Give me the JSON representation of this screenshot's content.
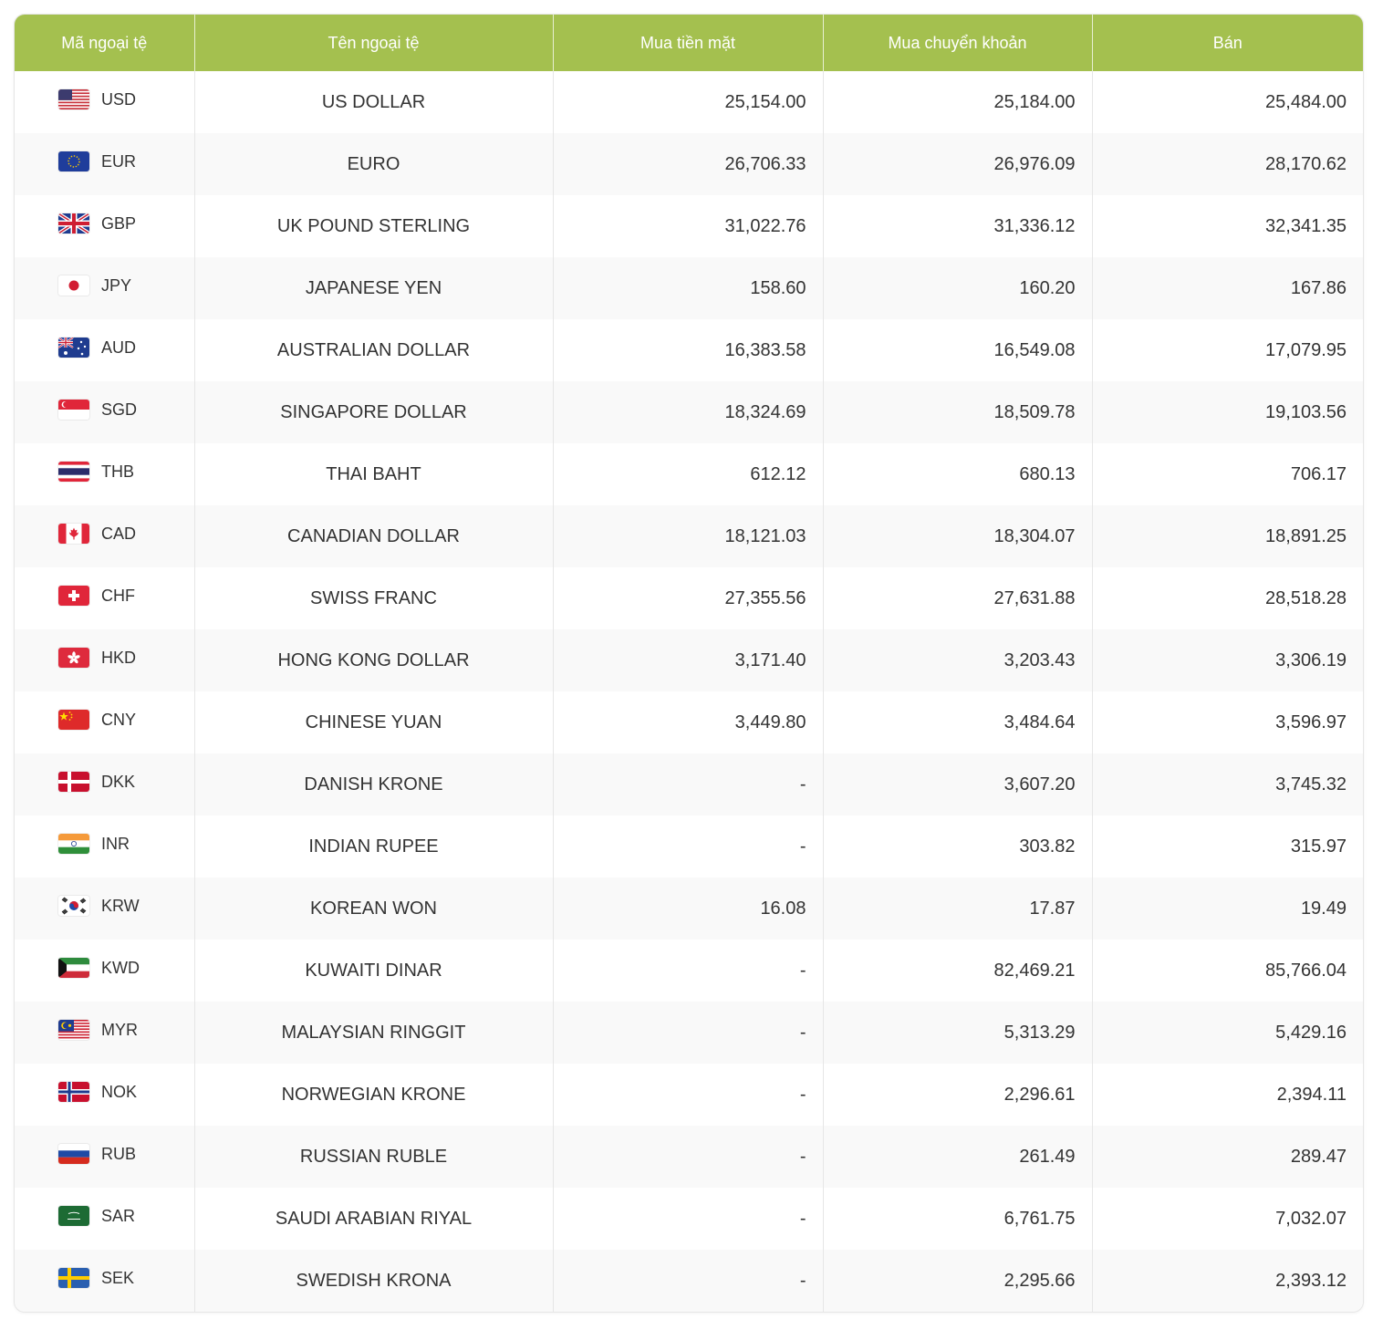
{
  "table": {
    "headers": {
      "code": "Mã ngoại tệ",
      "name": "Tên ngoại tệ",
      "cash_buy": "Mua tiền mặt",
      "transfer_buy": "Mua chuyển khoản",
      "sell": "Bán"
    },
    "header_color": "#a4c04f",
    "rows": [
      {
        "code": "USD",
        "flag": "us-flag",
        "name": "US DOLLAR",
        "cash": "25,154.00",
        "transfer": "25,184.00",
        "sell": "25,484.00"
      },
      {
        "code": "EUR",
        "flag": "eu-flag",
        "name": "EURO",
        "cash": "26,706.33",
        "transfer": "26,976.09",
        "sell": "28,170.62"
      },
      {
        "code": "GBP",
        "flag": "uk-flag",
        "name": "UK POUND STERLING",
        "cash": "31,022.76",
        "transfer": "31,336.12",
        "sell": "32,341.35"
      },
      {
        "code": "JPY",
        "flag": "japan-flag",
        "name": "JAPANESE YEN",
        "cash": "158.60",
        "transfer": "160.20",
        "sell": "167.86"
      },
      {
        "code": "AUD",
        "flag": "australia-flag",
        "name": "AUSTRALIAN DOLLAR",
        "cash": "16,383.58",
        "transfer": "16,549.08",
        "sell": "17,079.95"
      },
      {
        "code": "SGD",
        "flag": "singapore-flag",
        "name": "SINGAPORE DOLLAR",
        "cash": "18,324.69",
        "transfer": "18,509.78",
        "sell": "19,103.56"
      },
      {
        "code": "THB",
        "flag": "thailand-flag",
        "name": "THAI BAHT",
        "cash": "612.12",
        "transfer": "680.13",
        "sell": "706.17"
      },
      {
        "code": "CAD",
        "flag": "canada-flag",
        "name": "CANADIAN DOLLAR",
        "cash": "18,121.03",
        "transfer": "18,304.07",
        "sell": "18,891.25"
      },
      {
        "code": "CHF",
        "flag": "switzerland-flag",
        "name": "SWISS FRANC",
        "cash": "27,355.56",
        "transfer": "27,631.88",
        "sell": "28,518.28"
      },
      {
        "code": "HKD",
        "flag": "hong-kong-flag",
        "name": "HONG KONG DOLLAR",
        "cash": "3,171.40",
        "transfer": "3,203.43",
        "sell": "3,306.19"
      },
      {
        "code": "CNY",
        "flag": "china-flag",
        "name": "CHINESE YUAN",
        "cash": "3,449.80",
        "transfer": "3,484.64",
        "sell": "3,596.97"
      },
      {
        "code": "DKK",
        "flag": "denmark-flag",
        "name": "DANISH KRONE",
        "cash": "-",
        "transfer": "3,607.20",
        "sell": "3,745.32"
      },
      {
        "code": "INR",
        "flag": "india-flag",
        "name": "INDIAN RUPEE",
        "cash": "-",
        "transfer": "303.82",
        "sell": "315.97"
      },
      {
        "code": "KRW",
        "flag": "south-korea-flag",
        "name": "KOREAN WON",
        "cash": "16.08",
        "transfer": "17.87",
        "sell": "19.49"
      },
      {
        "code": "KWD",
        "flag": "kuwait-flag",
        "name": "KUWAITI DINAR",
        "cash": "-",
        "transfer": "82,469.21",
        "sell": "85,766.04"
      },
      {
        "code": "MYR",
        "flag": "malaysia-flag",
        "name": "MALAYSIAN RINGGIT",
        "cash": "-",
        "transfer": "5,313.29",
        "sell": "5,429.16"
      },
      {
        "code": "NOK",
        "flag": "norway-flag",
        "name": "NORWEGIAN KRONE",
        "cash": "-",
        "transfer": "2,296.61",
        "sell": "2,394.11"
      },
      {
        "code": "RUB",
        "flag": "russia-flag",
        "name": "RUSSIAN RUBLE",
        "cash": "-",
        "transfer": "261.49",
        "sell": "289.47"
      },
      {
        "code": "SAR",
        "flag": "saudi-arabia-flag",
        "name": "SAUDI ARABIAN RIYAL",
        "cash": "-",
        "transfer": "6,761.75",
        "sell": "7,032.07"
      },
      {
        "code": "SEK",
        "flag": "sweden-flag",
        "name": "SWEDISH KRONA",
        "cash": "-",
        "transfer": "2,295.66",
        "sell": "2,393.12"
      }
    ]
  }
}
